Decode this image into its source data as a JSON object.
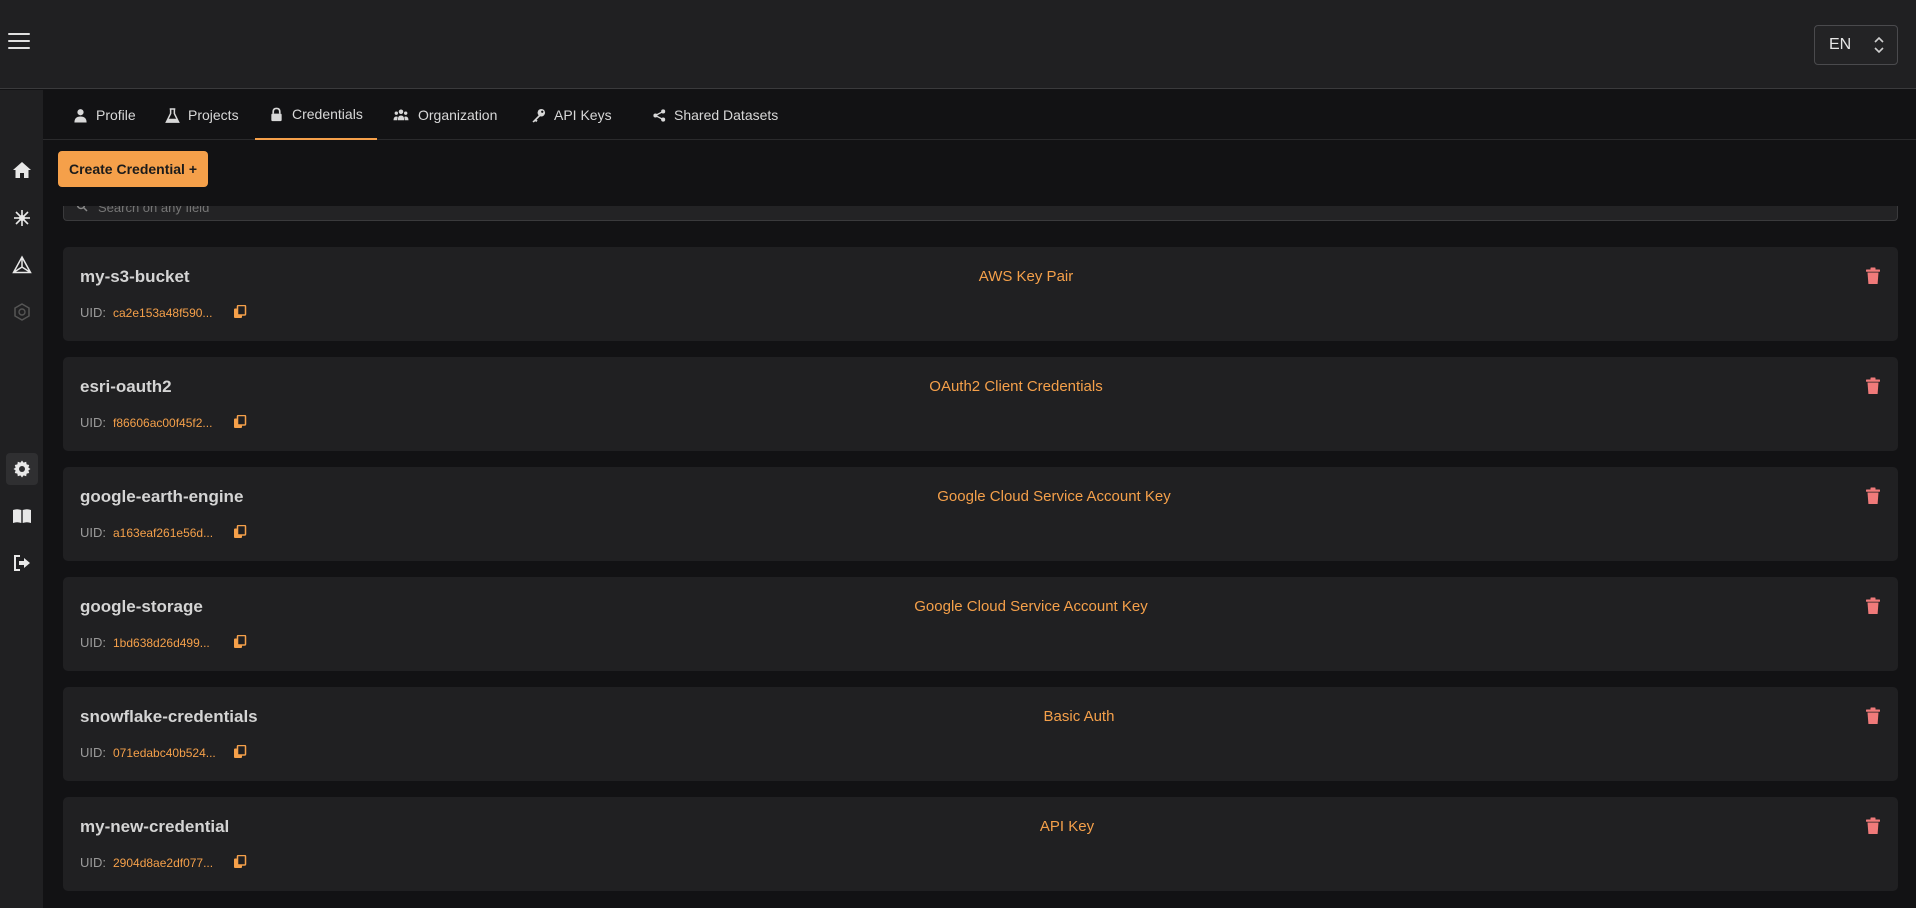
{
  "language": {
    "selected": "EN"
  },
  "sidebar": {
    "items": [
      {
        "icon": "home-icon"
      },
      {
        "icon": "sparkle-icon"
      },
      {
        "icon": "triangle-icon"
      },
      {
        "icon": "hexagon-icon"
      },
      {
        "icon": "gear-icon",
        "active": true
      },
      {
        "icon": "book-icon"
      },
      {
        "icon": "logout-icon"
      }
    ]
  },
  "tabs": [
    {
      "label": "Profile",
      "icon": "user-icon"
    },
    {
      "label": "Projects",
      "icon": "flask-icon"
    },
    {
      "label": "Credentials",
      "icon": "lock-icon",
      "active": true
    },
    {
      "label": "Organization",
      "icon": "users-icon"
    },
    {
      "label": "API Keys",
      "icon": "key-icon"
    },
    {
      "label": "Shared Datasets",
      "icon": "share-icon"
    }
  ],
  "create_button": {
    "label": "Create Credential +"
  },
  "search": {
    "placeholder": "Search on any field"
  },
  "uid_label": "UID:",
  "credentials": [
    {
      "name": "my-s3-bucket",
      "uid": "ca2e153a48f590...",
      "type": "AWS Key Pair"
    },
    {
      "name": "esri-oauth2",
      "uid": "f86606ac00f45f2...",
      "type": "OAuth2 Client Credentials"
    },
    {
      "name": "google-earth-engine",
      "uid": "a163eaf261e56d...",
      "type": "Google Cloud Service Account Key"
    },
    {
      "name": "google-storage",
      "uid": "1bd638d26d499...",
      "type": "Google Cloud Service Account Key"
    },
    {
      "name": "snowflake-credentials",
      "uid": "071edabc40b524...",
      "type": "Basic Auth"
    },
    {
      "name": "my-new-credential",
      "uid": "2904d8ae2df077...",
      "type": "API Key"
    }
  ],
  "colors": {
    "accent": "#f5a04a",
    "delete": "#f07a7a",
    "background": "#121214",
    "card": "#202022"
  }
}
